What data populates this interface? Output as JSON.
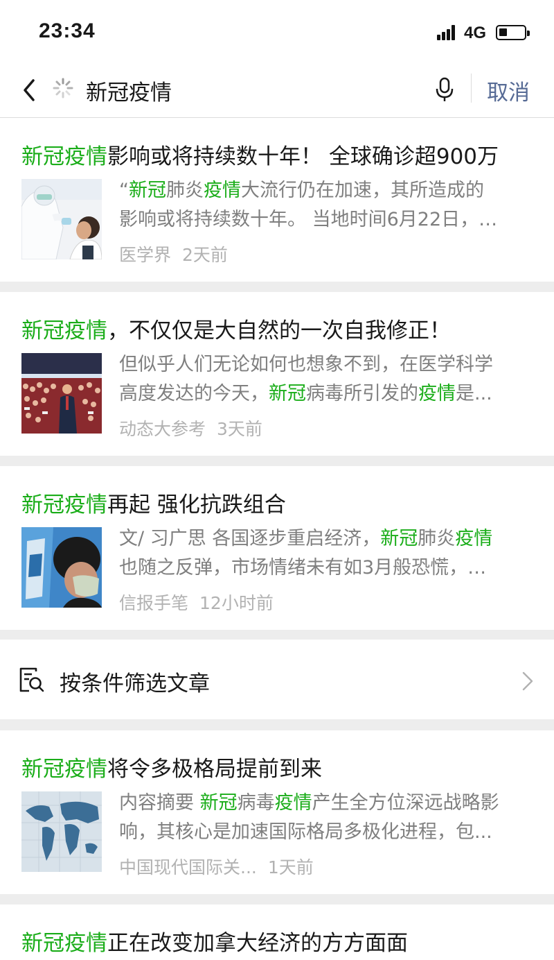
{
  "status_bar": {
    "time": "23:34",
    "network": "4G"
  },
  "search": {
    "query": "新冠疫情",
    "cancel_label": "取消"
  },
  "keyword": "新冠疫情",
  "results": [
    {
      "title_rest": "影响或将持续数十年！ 全球确诊超900万",
      "snippet": [
        [
          [
            "“",
            false
          ],
          [
            "新冠",
            true
          ],
          [
            "肺炎",
            false
          ],
          [
            "疫情",
            true
          ],
          [
            "大流行仍在加速，其所造成的",
            false
          ]
        ],
        [
          [
            "影响或将持续数十年。 当地时间6月22日，…",
            false
          ]
        ]
      ],
      "source": "医学界",
      "time": "2天前",
      "thumb": "medical-worker-swab-test"
    },
    {
      "title_rest": "，不仅仅是大自然的一次自我修正！",
      "snippet": [
        [
          [
            "但似乎人们无论如何也想象不到，在医学科学",
            false
          ]
        ],
        [
          [
            "高度发达的今天，",
            false
          ],
          [
            "新冠",
            true
          ],
          [
            "病毒所引发的",
            false
          ],
          [
            "疫情",
            true
          ],
          [
            "是...",
            false
          ]
        ]
      ],
      "source": "动态大参考",
      "time": "3天前",
      "thumb": "crowd-rally"
    },
    {
      "title_rest": "再起 强化抗跌组合",
      "snippet": [
        [
          [
            "文/ 习广思 各国逐步重启经济，",
            false
          ],
          [
            "新冠",
            true
          ],
          [
            "肺炎",
            false
          ],
          [
            "疫情",
            true
          ]
        ],
        [
          [
            "也随之反弹，市场情绪未有如3月般恐慌，…",
            false
          ]
        ]
      ],
      "source": "信报手笔",
      "time": "12小时前",
      "thumb": "woman-with-mask"
    },
    {
      "title_rest": "将令多极格局提前到来",
      "snippet": [
        [
          [
            "内容摘要 ",
            false
          ],
          [
            "新冠",
            true
          ],
          [
            "病毒",
            false
          ],
          [
            "疫情",
            true
          ],
          [
            "产生全方位深远战略影",
            false
          ]
        ],
        [
          [
            "响，其核心是加速国际格局多极化进程，包...",
            false
          ]
        ]
      ],
      "source": "中国现代国际关...",
      "time": "1天前",
      "thumb": "world-map"
    },
    {
      "title_rest": "正在改变加拿大经济的方方面面"
    }
  ],
  "filter": {
    "label": "按条件筛选文章"
  },
  "colors": {
    "highlight": "#1aad19",
    "link": "#576b95",
    "snippet": "#7f7f7f",
    "meta": "#b2b2b2"
  }
}
